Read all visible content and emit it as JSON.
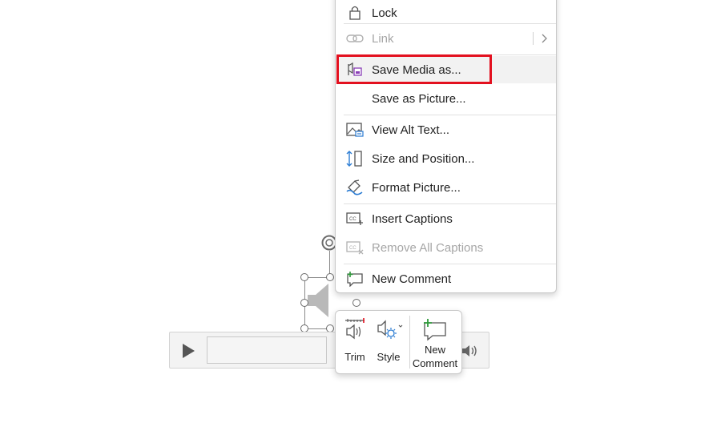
{
  "context_menu": {
    "items": [
      {
        "label": "Lock",
        "icon": "lock-icon",
        "enabled": true
      },
      {
        "label": "Link",
        "icon": "link-icon",
        "enabled": false,
        "has_submenu": true
      },
      {
        "label": "Save Media as...",
        "icon": "save-media-icon",
        "enabled": true,
        "highlighted": true
      },
      {
        "label": "Save as Picture...",
        "icon": "",
        "enabled": true
      },
      {
        "label": "View Alt Text...",
        "icon": "alt-text-icon",
        "enabled": true
      },
      {
        "label": "Size and Position...",
        "icon": "size-position-icon",
        "enabled": true
      },
      {
        "label": "Format Picture...",
        "icon": "format-picture-icon",
        "enabled": true
      },
      {
        "label": "Insert Captions",
        "icon": "insert-captions-icon",
        "enabled": true
      },
      {
        "label": "Remove All Captions",
        "icon": "remove-captions-icon",
        "enabled": false
      },
      {
        "label": "New Comment",
        "icon": "new-comment-icon",
        "enabled": true
      }
    ]
  },
  "mini_toolbar": {
    "trim_label": "Trim",
    "style_label": "Style",
    "new_comment_label_line1": "New",
    "new_comment_label_line2": "Comment"
  },
  "colors": {
    "highlight": "#e3101f",
    "accent_blue": "#2b7cd3",
    "comment_green": "#2e9a3a"
  }
}
